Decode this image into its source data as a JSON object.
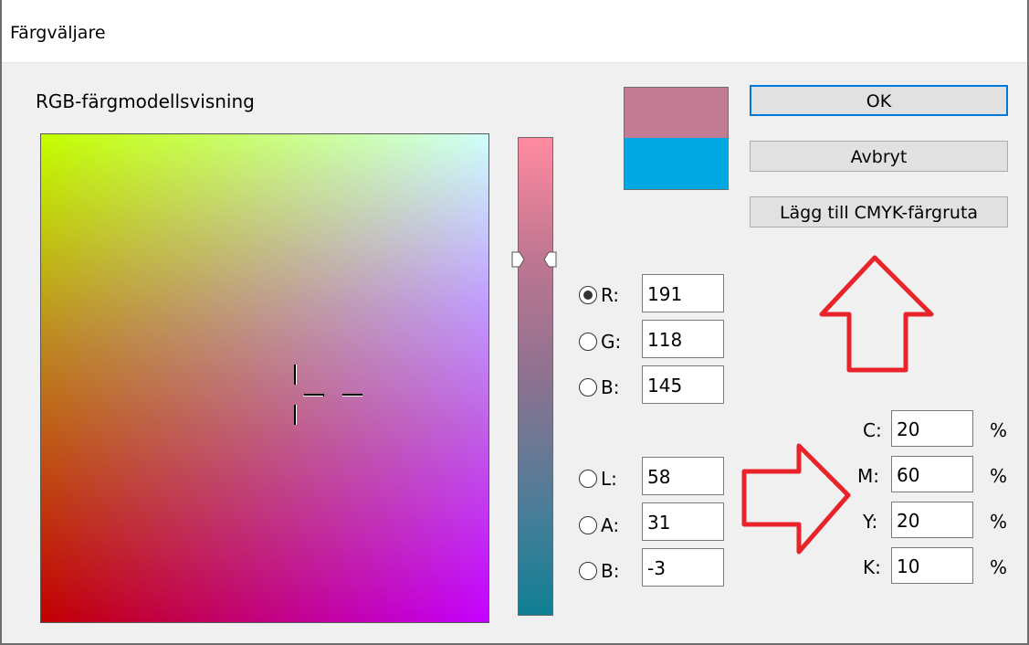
{
  "window": {
    "title": "Färgväljare"
  },
  "view": {
    "label": "RGB-färgmodellsvisning"
  },
  "colors": {
    "new": "#c17b92",
    "old": "#00a8e4",
    "annotation": "#e8232a",
    "focus": "#0078d7"
  },
  "buttons": {
    "ok": "OK",
    "cancel": "Avbryt",
    "add_swatch": "Lägg till CMYK-färgruta"
  },
  "rgb": [
    {
      "label": "R:",
      "value": "191",
      "selected": true
    },
    {
      "label": "G:",
      "value": "118",
      "selected": false
    },
    {
      "label": "B:",
      "value": "145",
      "selected": false
    }
  ],
  "lab": [
    {
      "label": "L:",
      "value": "58",
      "selected": false
    },
    {
      "label": "A:",
      "value": "31",
      "selected": false
    },
    {
      "label": "B:",
      "value": "-3",
      "selected": false
    }
  ],
  "cmyk": [
    {
      "label": "C:",
      "value": "20",
      "unit": "%"
    },
    {
      "label": "M:",
      "value": "60",
      "unit": "%"
    },
    {
      "label": "Y:",
      "value": "20",
      "unit": "%"
    },
    {
      "label": "K:",
      "value": "10",
      "unit": "%"
    }
  ],
  "annotations": [
    "up-arrow",
    "right-arrow"
  ]
}
